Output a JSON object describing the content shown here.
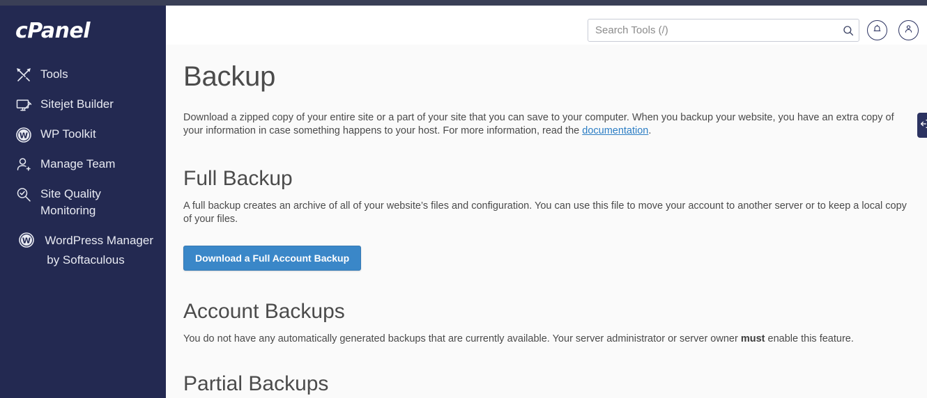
{
  "brand": {
    "logo_text": "cPanel",
    "sidebar_color": "#232951",
    "accent_blue": "#3a87c8",
    "link_blue": "#2b7dc4"
  },
  "sidebar": {
    "items": [
      {
        "label": "Tools",
        "icon": "tools-icon"
      },
      {
        "label": "Sitejet Builder",
        "icon": "monitor-pen-icon"
      },
      {
        "label": "WP Toolkit",
        "icon": "wordpress-icon"
      },
      {
        "label": "Manage Team",
        "icon": "user-plus-icon"
      },
      {
        "label": "Site Quality Monitoring",
        "icon": "magnifier-check-icon"
      },
      {
        "label": "WordPress Manager by Softaculous",
        "icon": "wordpress-icon"
      }
    ]
  },
  "header": {
    "search": {
      "placeholder": "Search Tools (/)",
      "value": "",
      "icon": "search-icon"
    },
    "notifications_icon": "bell-icon",
    "account_icon": "user-icon"
  },
  "main": {
    "title": "Backup",
    "intro_part1": "Download a zipped copy of your entire site or a part of your site that you can save to your computer. When you backup your website, you have an extra copy of your information in case something happens to your host. For more information, read the ",
    "intro_link": "documentation",
    "intro_part2": ".",
    "full_backup": {
      "heading": "Full Backup",
      "text": "A full backup creates an archive of all of your website’s files and configuration. You can use this file to move your account to another server or to keep a local copy of your files.",
      "button_label": "Download a Full Account Backup"
    },
    "account_backups": {
      "heading": "Account Backups",
      "text_part1": "You do not have any automatically generated backups that are currently available. Your server administrator or server owner ",
      "text_strong": "must",
      "text_part2": " enable this feature."
    },
    "partial_backups": {
      "heading": "Partial Backups"
    }
  },
  "edge_tab": {
    "icon": "feedback-tab-icon"
  }
}
